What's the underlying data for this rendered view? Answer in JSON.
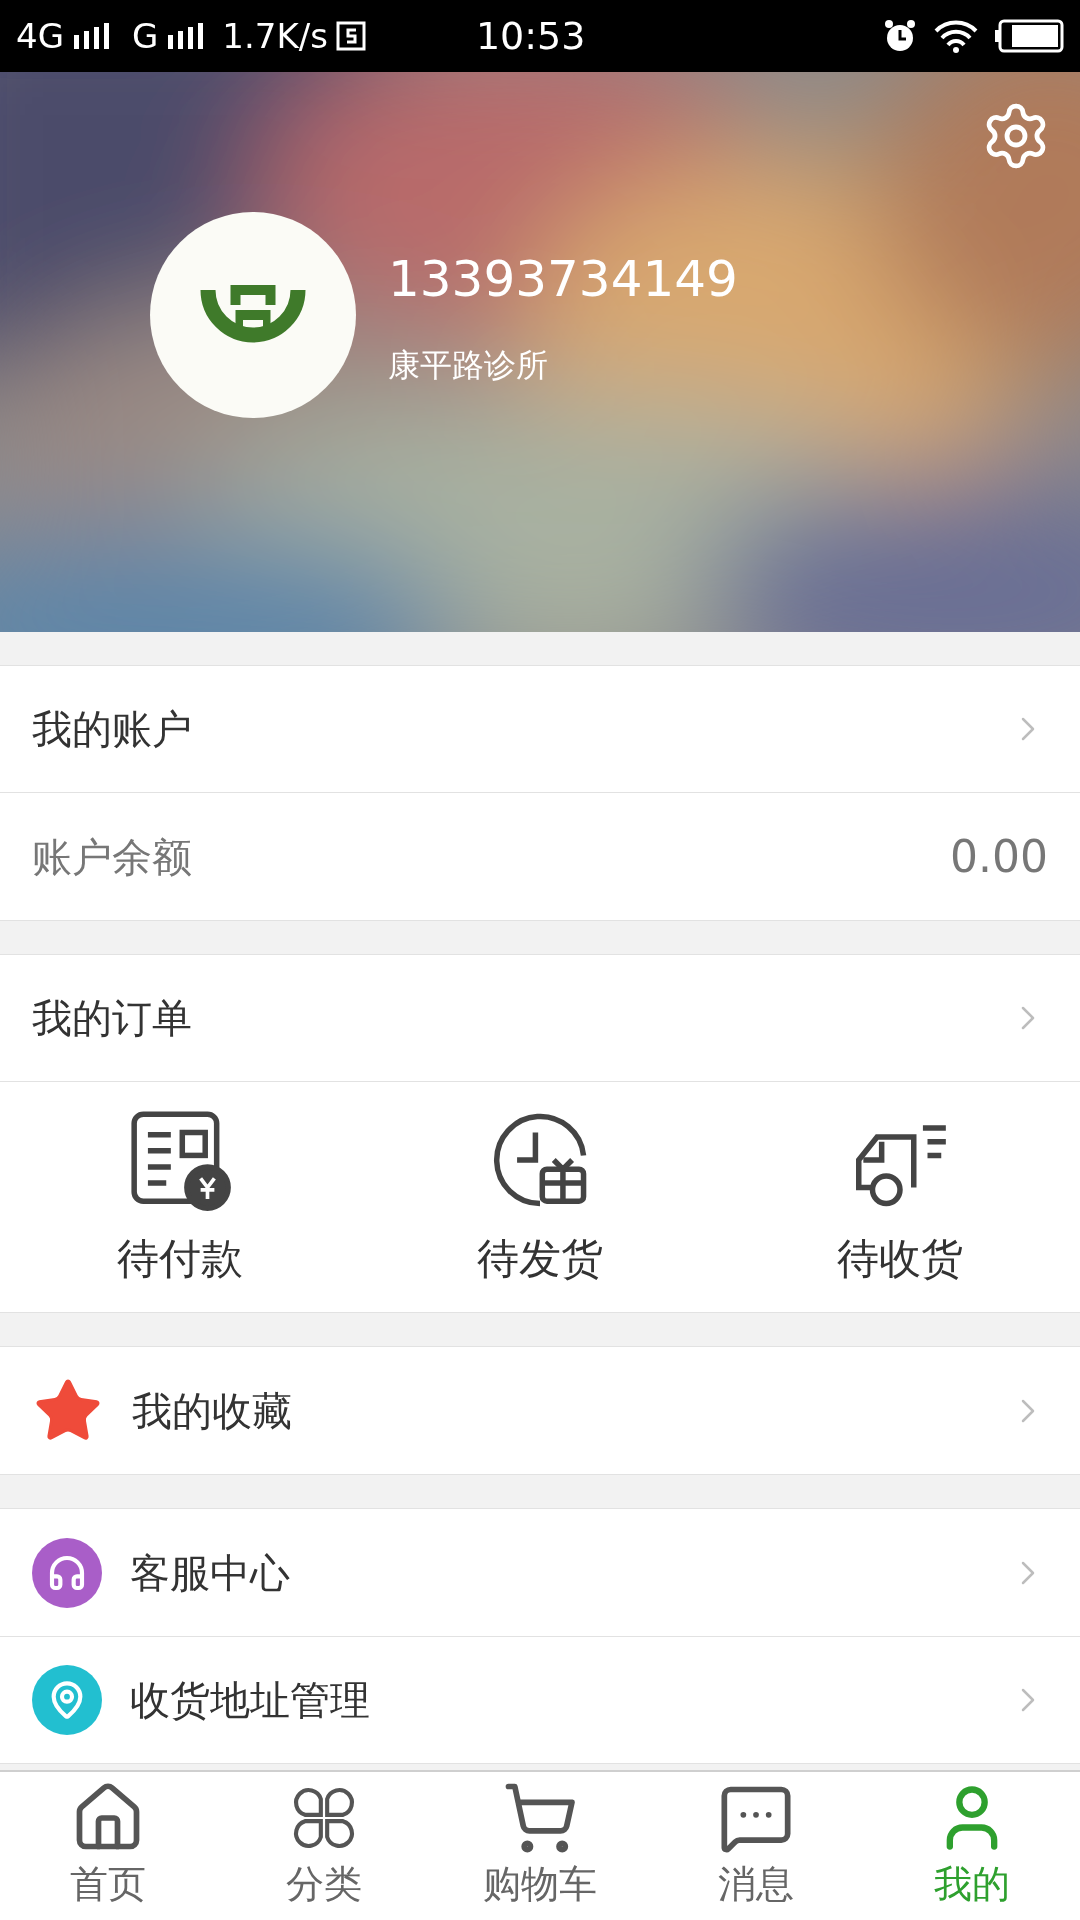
{
  "status_bar": {
    "network_1": "4G",
    "network_2": "G",
    "speed": "1.7K/s",
    "time": "10:53"
  },
  "profile": {
    "phone": "13393734149",
    "name": "康平路诊所"
  },
  "account": {
    "title": "我的账户",
    "balance_label": "账户余额",
    "balance": "0.00"
  },
  "orders": {
    "title": "我的订单",
    "items": [
      {
        "label": "待付款",
        "kind": "payment"
      },
      {
        "label": "待发货",
        "kind": "shipping"
      },
      {
        "label": "待收货",
        "kind": "delivery"
      }
    ]
  },
  "menu_groups": [
    {
      "items": [
        {
          "label": "我的收藏",
          "kind": "favorites"
        }
      ]
    },
    {
      "items": [
        {
          "label": "客服中心",
          "kind": "service"
        },
        {
          "label": "收货地址管理",
          "kind": "address"
        }
      ]
    }
  ],
  "nav": [
    {
      "label": "首页",
      "kind": "home",
      "selected": false
    },
    {
      "label": "分类",
      "kind": "category",
      "selected": false
    },
    {
      "label": "购物车",
      "kind": "cart",
      "selected": false
    },
    {
      "label": "消息",
      "kind": "message",
      "selected": false
    },
    {
      "label": "我的",
      "kind": "profile",
      "selected": true
    }
  ]
}
